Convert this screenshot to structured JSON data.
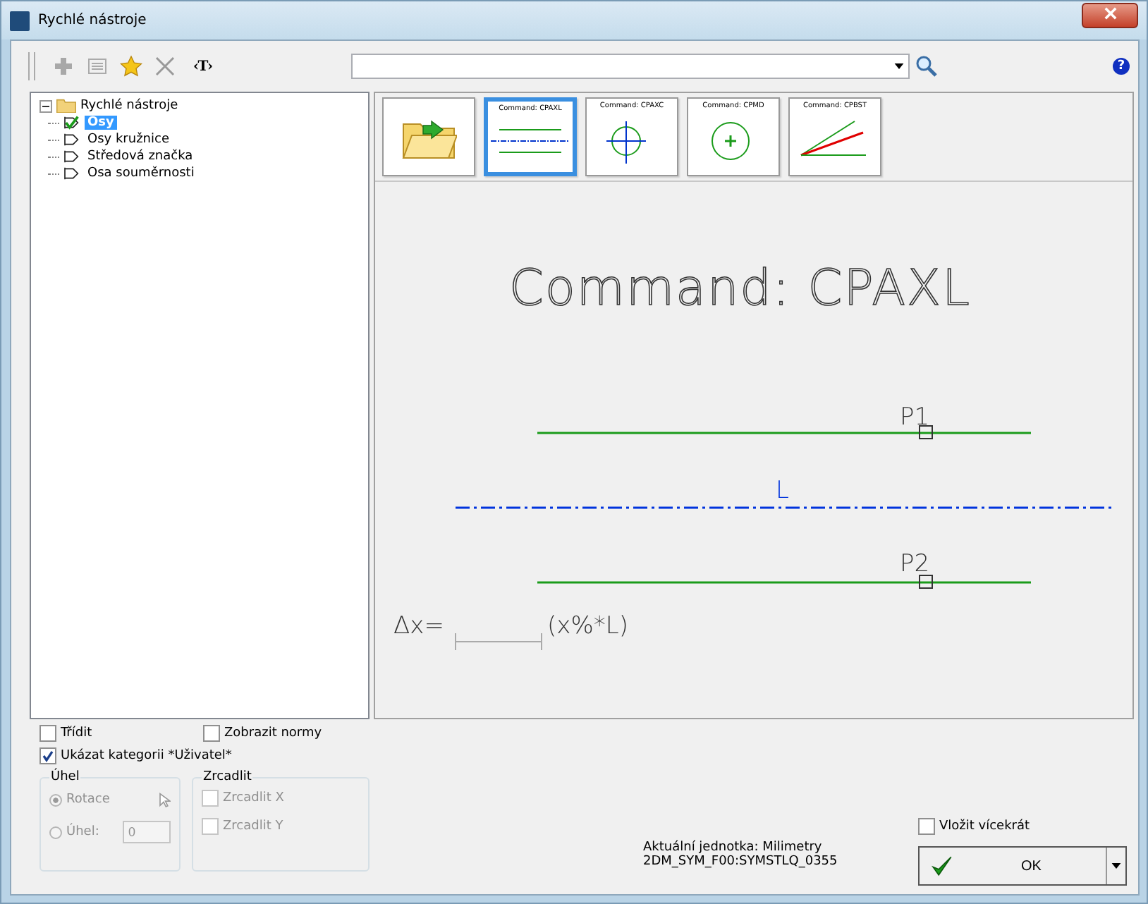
{
  "window": {
    "title": "Rychlé nástroje"
  },
  "toolbar": {
    "format_button": "‹T›",
    "help": "?"
  },
  "tree": {
    "label": "Rychlé nástroje",
    "expanded": true,
    "children": [
      {
        "label": "Osy",
        "selected": true
      },
      {
        "label": "Osy kružnice",
        "selected": false
      },
      {
        "label": "Středová značka",
        "selected": false
      },
      {
        "label": "Osa souměrnosti",
        "selected": false
      }
    ]
  },
  "thumbnails": [
    {
      "kind": "folder",
      "selected": false
    },
    {
      "kind": "axis",
      "title": "Command: CPAXL",
      "selected": true
    },
    {
      "kind": "circle",
      "title": "Command: CPAXC",
      "selected": false
    },
    {
      "kind": "mark",
      "title": "Command: CPMD",
      "selected": false
    },
    {
      "kind": "symmetry",
      "title": "Command: CPBST",
      "selected": false
    }
  ],
  "preview": {
    "title": "Command:  CPAXL",
    "p1": "P1",
    "l": "L",
    "p2": "P2",
    "dx": "Δx=",
    "formula": "(x%*L)"
  },
  "options": [
    {
      "label": "Třídit",
      "checked": false
    },
    {
      "label": "Zobrazit normy",
      "checked": false
    },
    {
      "label": "Ukázat kategorii *Uživatel*",
      "checked": true
    }
  ],
  "angle_group": {
    "title": "Úhel",
    "disabled": true,
    "radios": [
      {
        "label": "Rotace",
        "selected": true
      },
      {
        "label": "Úhel:",
        "selected": false
      }
    ],
    "value": "0"
  },
  "mirror_group": {
    "title": "Zrcadlit",
    "disabled": true,
    "checks": [
      {
        "label": "Zrcadlit X",
        "checked": false
      },
      {
        "label": "Zrcadlit Y",
        "checked": false
      }
    ]
  },
  "status": [
    "Aktuální jednotka: Milimetry",
    "2DM_SYM_F00:SYMSTLQ_0355"
  ],
  "insert_multiple": {
    "label": "Vložit vícekrát",
    "checked": false
  },
  "ok_button": "OK"
}
